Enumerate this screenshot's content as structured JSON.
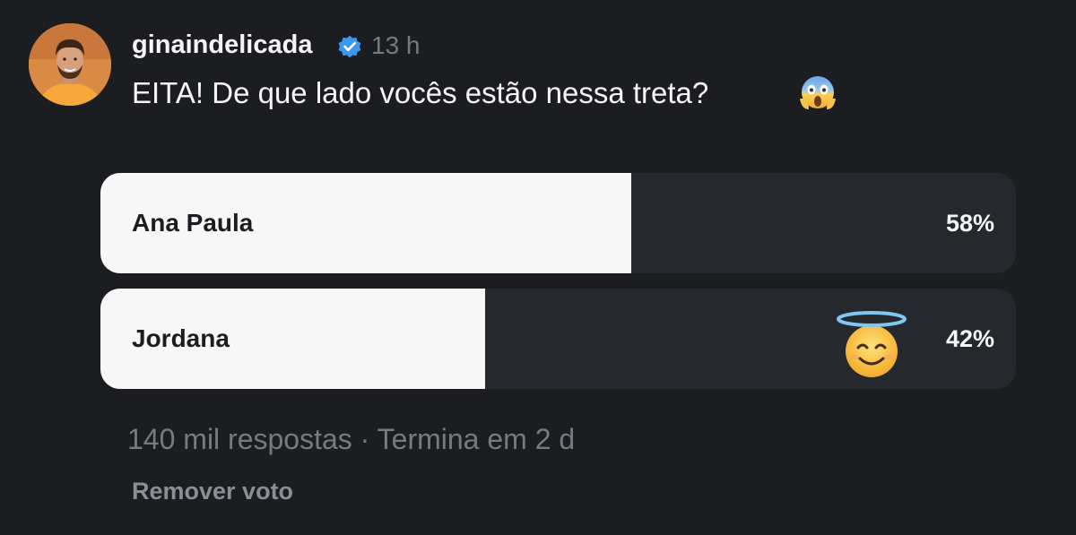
{
  "post": {
    "username": "ginaindelicada",
    "time": "13 h",
    "text": "EITA! De que lado vocês estão nessa treta?",
    "text_emoji": "screaming-face-emoji"
  },
  "poll": {
    "options": [
      {
        "label": "Ana Paula",
        "percent_label": "58%",
        "percent": 58,
        "selected": false
      },
      {
        "label": "Jordana",
        "percent_label": "42%",
        "percent": 42,
        "selected": true
      }
    ],
    "fill_color": "#f7f7f7",
    "track_color": "#25282c",
    "meta": "140 mil respostas · Termina em 2 d",
    "remove_vote": "Remover voto"
  },
  "colors": {
    "background": "#1b1d20",
    "verified": "#3b97f0",
    "secondary_text": "#777b81"
  },
  "icons": {
    "verified": "verified-badge-icon",
    "voted_emoji": "smiling-face-with-halo-emoji"
  }
}
